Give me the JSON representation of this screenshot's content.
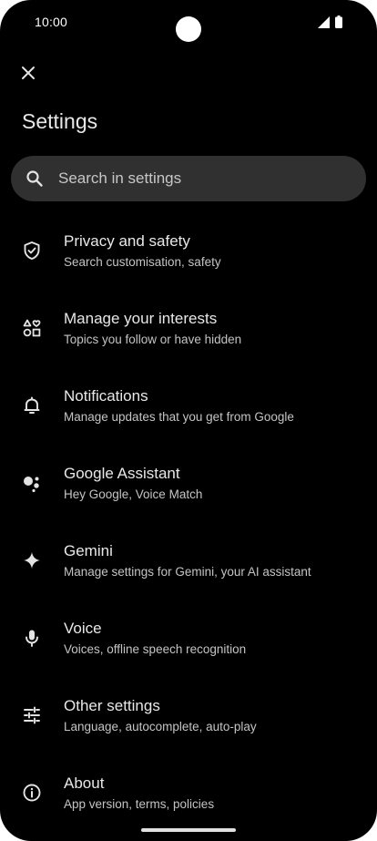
{
  "status_bar": {
    "time": "10:00",
    "icons": [
      "cellular-signal-icon",
      "battery-icon"
    ]
  },
  "header": {
    "close_icon": "close-icon",
    "title": "Settings"
  },
  "search": {
    "placeholder": "Search in settings",
    "value": "",
    "icon": "search-icon"
  },
  "items": [
    {
      "icon": "shield-check-icon",
      "title": "Privacy and safety",
      "subtitle": "Search customisation, safety"
    },
    {
      "icon": "interests-shapes-icon",
      "title": "Manage your interests",
      "subtitle": "Topics you follow or have hidden"
    },
    {
      "icon": "bell-icon",
      "title": "Notifications",
      "subtitle": "Manage updates that you get from Google"
    },
    {
      "icon": "google-assistant-icon",
      "title": "Google Assistant",
      "subtitle": "Hey Google, Voice Match"
    },
    {
      "icon": "sparkle-icon",
      "title": "Gemini",
      "subtitle": "Manage settings for Gemini, your AI assistant"
    },
    {
      "icon": "microphone-icon",
      "title": "Voice",
      "subtitle": "Voices, offline speech recognition"
    },
    {
      "icon": "sliders-icon",
      "title": "Other settings",
      "subtitle": "Language, autocomplete, auto-play"
    },
    {
      "icon": "info-icon",
      "title": "About",
      "subtitle": "App version, terms, policies"
    }
  ],
  "colors": {
    "background": "#000000",
    "search_bg": "#303030",
    "text_primary": "#e8e8e8",
    "text_secondary": "#c4c4c4"
  }
}
